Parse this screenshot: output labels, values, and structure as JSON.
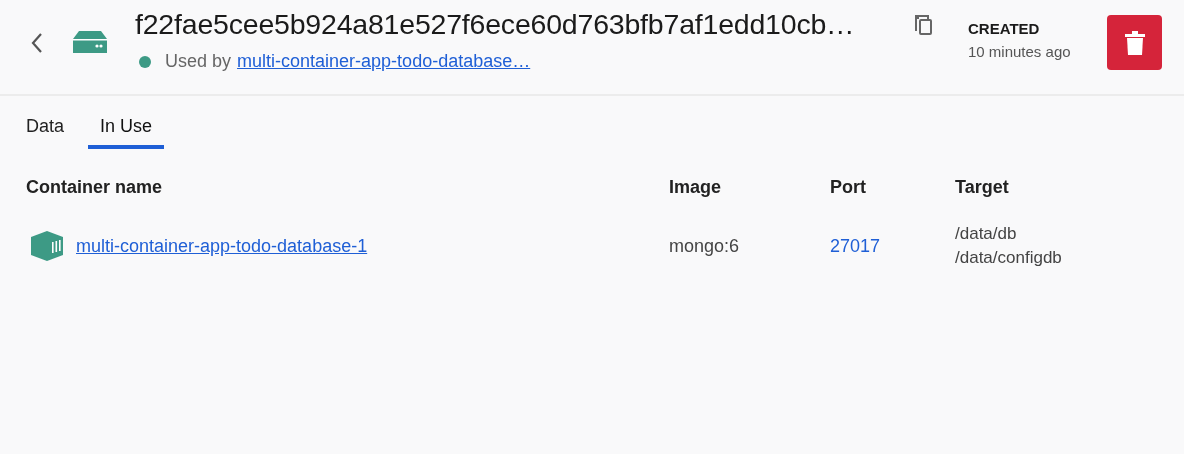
{
  "header": {
    "title": "f22fae5cee5b924a81e527f6ece60d763bfb7af1edd10cb…",
    "used_by_label": "Used by",
    "used_by_link": "multi-container-app-todo-database…",
    "created_label": "CREATED",
    "created_value": "10 minutes ago"
  },
  "tabs": [
    {
      "label": "Data",
      "selected": false
    },
    {
      "label": "In Use",
      "selected": true
    }
  ],
  "table": {
    "columns": [
      "Container name",
      "Image",
      "Port",
      "Target"
    ],
    "rows": [
      {
        "container_name": "multi-container-app-todo-database-1",
        "image": "mongo:6",
        "port": "27017",
        "target": [
          "/data/db",
          "/data/configdb"
        ]
      }
    ]
  }
}
